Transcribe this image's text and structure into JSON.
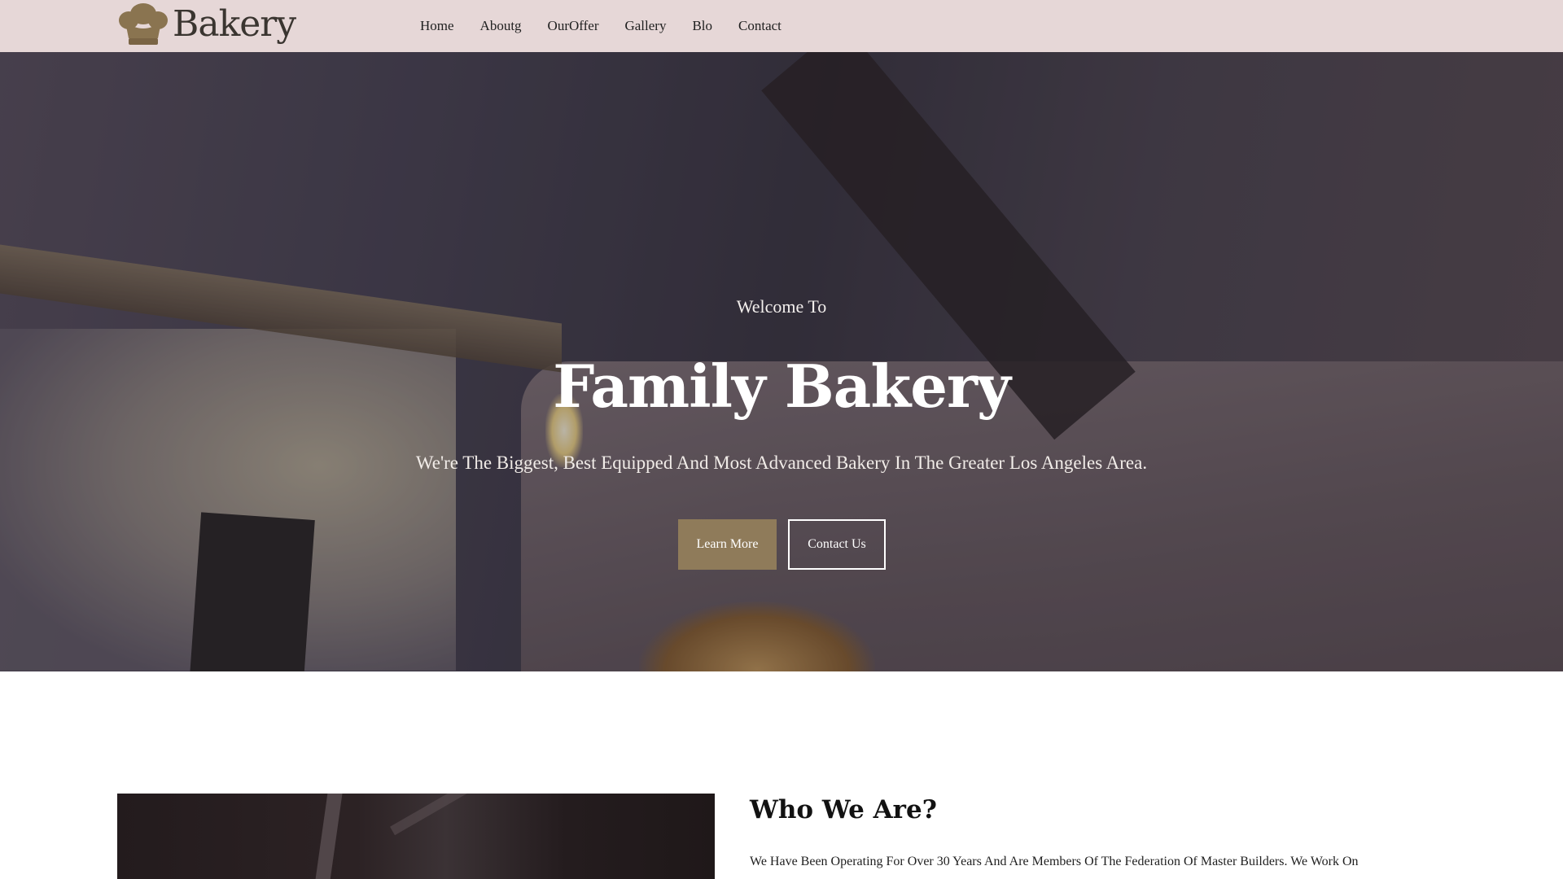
{
  "header": {
    "logo_text": "Bakery",
    "logo_icon": "chef-hat-icon",
    "nav": [
      {
        "label": "Home"
      },
      {
        "label": "Aboutg"
      },
      {
        "label": "OurOffer"
      },
      {
        "label": "Gallery"
      },
      {
        "label": "Blo"
      },
      {
        "label": "Contact"
      }
    ]
  },
  "hero": {
    "eyebrow": "Welcome To",
    "title": "Family Bakery",
    "subtitle": "We're The Biggest, Best Equipped And Most Advanced Bakery In The Greater Los Angeles Area.",
    "primary_button": "Learn More",
    "secondary_button": "Contact Us"
  },
  "about": {
    "title": "Who We Are?",
    "text": "We Have Been Operating For Over 30 Years And Are Members Of The Federation Of Master Builders. We Work On"
  },
  "colors": {
    "header_bg": "#e6d7d7",
    "accent": "#8f7b5a",
    "logo_brown": "#8a7450"
  }
}
